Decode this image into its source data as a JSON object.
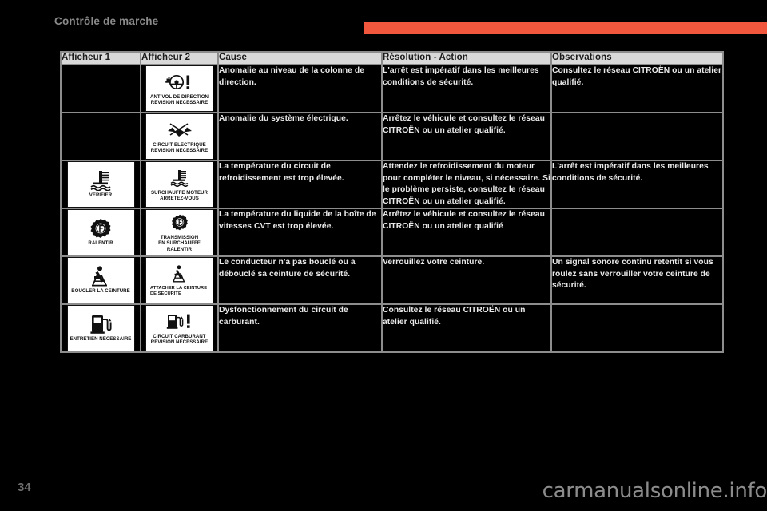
{
  "header": {
    "title": "Contrôle de marche",
    "accent_color": "#f0573c"
  },
  "table": {
    "columns": [
      "Afficheur 1",
      "Afficheur 2",
      "Cause",
      "Résolution - Action",
      "Observations"
    ],
    "rows": [
      {
        "display1": {
          "icon": "steering-wheel-warning-icon",
          "caption": "ANTIVOL DE DIRECTION\nREVISION NECESSAIRE",
          "present": false
        },
        "display2": {
          "icon": "steering-wheel-warning-icon",
          "caption": "ANTIVOL DE DIRECTION\nREVISION NECESSAIRE",
          "present": true
        },
        "cause": "Anomalie au niveau de la colonne de direction.",
        "action": "L'arrêt est impératif dans les meilleures conditions de sécurité.",
        "observations": "Consultez le réseau CITROËN ou un atelier qualifié."
      },
      {
        "display1": {
          "icon": "electrical-circuit-icon",
          "caption": "CIRCUIT ELECTRIQUE\nREVISION NECESSAIRE",
          "present": false
        },
        "display2": {
          "icon": "electrical-circuit-icon",
          "caption": "CIRCUIT ELECTRIQUE\nREVISION NECESSAIRE",
          "present": true
        },
        "cause": "Anomalie du système électrique.",
        "action": "Arrêtez le véhicule et consultez le réseau CITROËN ou un atelier qualifié.",
        "observations": ""
      },
      {
        "display1": {
          "icon": "coolant-temperature-icon",
          "caption": "VERIFIER",
          "present": true
        },
        "display2": {
          "icon": "coolant-temperature-icon",
          "caption": "SURCHAUFFE MOTEUR\nARRETEZ-VOUS",
          "present": true
        },
        "cause": "La température du circuit de refroidissement est trop élevée.",
        "action": "Attendez le refroidissement du moteur pour compléter le niveau, si nécessaire. Si le problème persiste, consultez le réseau CITROËN ou un atelier qualifié.",
        "observations": "L'arrêt est impératif dans les meilleures conditions de sécurité."
      },
      {
        "display1": {
          "icon": "gearbox-overheat-icon",
          "caption": "RALENTIR",
          "present": true
        },
        "display2": {
          "icon": "gearbox-overheat-icon",
          "caption": "TRANSMISSION\nEN SURCHAUFFE\nRALENTIR",
          "present": true
        },
        "cause": "La température du liquide de la boîte de vitesses CVT est trop élevée.",
        "action": "Arrêtez le véhicule et consultez le réseau CITROËN ou un atelier qualifié",
        "observations": ""
      },
      {
        "display1": {
          "icon": "seatbelt-icon",
          "caption": "BOUCLER LA CEINTURE",
          "present": true
        },
        "display2": {
          "icon": "seatbelt-icon",
          "caption": "ATTACHER LA CEINTURE\nDE SECURITE",
          "present": true
        },
        "cause": "Le conducteur n'a pas bouclé ou a débouclé sa ceinture de sécurité.",
        "action": "Verrouillez votre ceinture.",
        "observations": "Un signal sonore continu retentit si vous roulez sans verrouiller votre ceinture de sécurité."
      },
      {
        "display1": {
          "icon": "fuel-pump-icon",
          "caption": "ENTRETIEN NECESSAIRE",
          "present": true
        },
        "display2": {
          "icon": "fuel-pump-warning-icon",
          "caption": "CIRCUIT CARBURANT\nREVISION NECESSAIRE",
          "present": true
        },
        "cause": "Dysfonctionnement du circuit de carburant.",
        "action": "Consultez le réseau CITROËN ou un atelier qualifié.",
        "observations": ""
      }
    ]
  },
  "footer": {
    "page_number": "34",
    "watermark": "carmanualsonline.info"
  }
}
